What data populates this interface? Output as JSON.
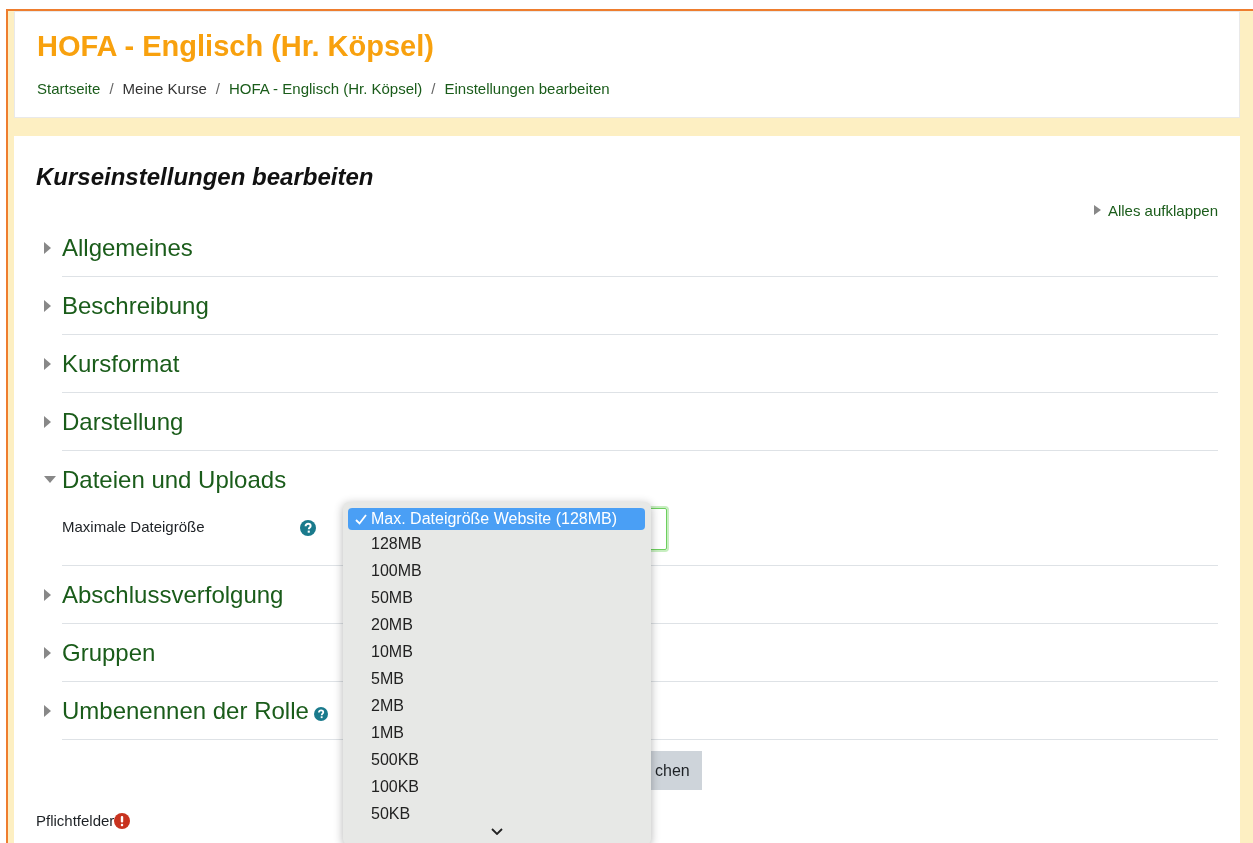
{
  "header": {
    "title": "HOFA - Englisch (Hr. Köpsel)",
    "separator": "/",
    "breadcrumb": [
      {
        "label": "Startseite",
        "link": true
      },
      {
        "label": "Meine Kurse",
        "link": false
      },
      {
        "label": "HOFA - Englisch (Hr. Köpsel)",
        "link": true
      },
      {
        "label": "Einstellungen bearbeiten",
        "link": true
      }
    ]
  },
  "form": {
    "title": "Kurseinstellungen bearbeiten",
    "expand_all": "Alles aufklappen",
    "sections": [
      {
        "title": "Allgemeines",
        "expanded": false
      },
      {
        "title": "Beschreibung",
        "expanded": false
      },
      {
        "title": "Kursformat",
        "expanded": false
      },
      {
        "title": "Darstellung",
        "expanded": false
      },
      {
        "title": "Dateien und Uploads",
        "expanded": true,
        "fields": [
          {
            "label": "Maximale Dateigröße",
            "help": true,
            "open": true,
            "options": [
              {
                "label": "Max. Dateigröße Website (128MB)",
                "selected": true
              },
              {
                "label": "128MB",
                "selected": false
              },
              {
                "label": "100MB",
                "selected": false
              },
              {
                "label": "50MB",
                "selected": false
              },
              {
                "label": "20MB",
                "selected": false
              },
              {
                "label": "10MB",
                "selected": false
              },
              {
                "label": "5MB",
                "selected": false
              },
              {
                "label": "2MB",
                "selected": false
              },
              {
                "label": "1MB",
                "selected": false
              },
              {
                "label": "500KB",
                "selected": false
              },
              {
                "label": "100KB",
                "selected": false
              },
              {
                "label": "50KB",
                "selected": false
              }
            ]
          }
        ]
      },
      {
        "title": "Abschlussverfolgung",
        "expanded": false
      },
      {
        "title": "Gruppen",
        "expanded": false
      },
      {
        "title": "Umbenennen der Rolle",
        "expanded": false,
        "help": true
      }
    ],
    "buttons": [
      "chen"
    ],
    "required_note": "Pflichtfelder"
  }
}
